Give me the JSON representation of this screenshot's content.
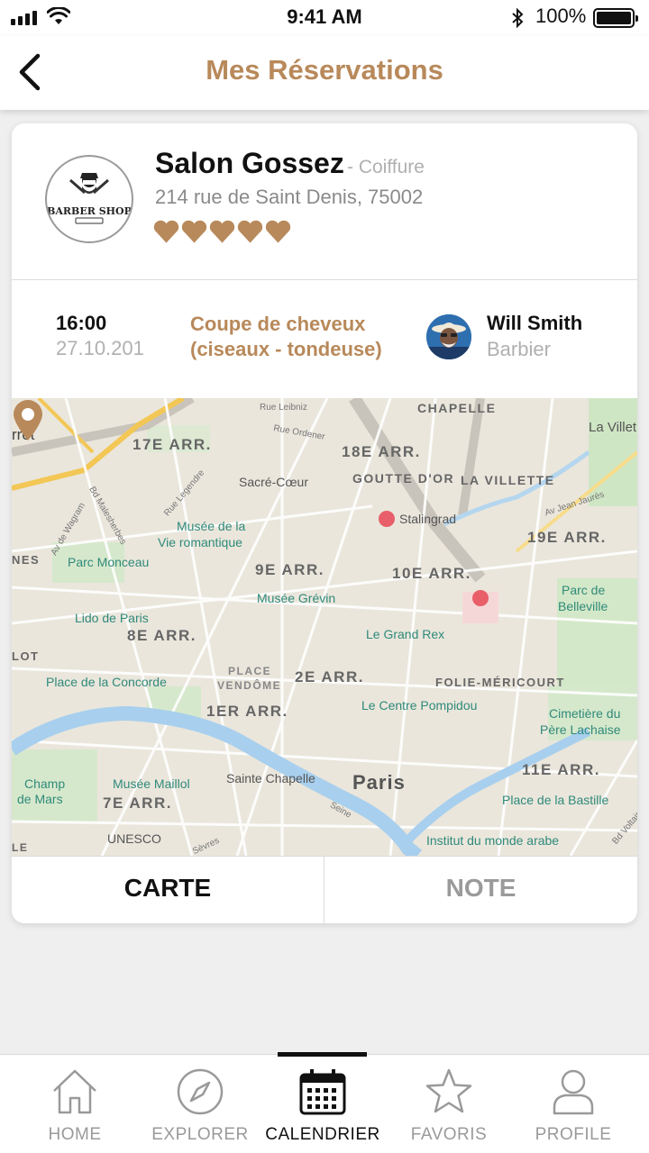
{
  "status": {
    "time": "9:41 AM",
    "battery": "100%"
  },
  "header": {
    "title": "Mes Réservations"
  },
  "salon": {
    "name": "Salon Gossez",
    "category": "- Coiffure",
    "address": "214 rue de Saint Denis, 75002",
    "logo_text": "BARBER SHOP",
    "rating": 5,
    "accent_color": "#b8895a"
  },
  "booking": {
    "time": "16:00",
    "date": "27.10.201",
    "service_line1": "Coupe de cheveux",
    "service_line2": "(ciseaux - tondeuse)",
    "barber_name": "Will Smith",
    "barber_role": "Barbier"
  },
  "map": {
    "labels": {
      "arr17": "17E ARR.",
      "arr18": "18E ARR.",
      "arr19": "19E ARR.",
      "arr9": "9E ARR.",
      "arr10": "10E ARR.",
      "arr8": "8E ARR.",
      "arr2": "2E ARR.",
      "arr1": "1ER ARR.",
      "arr11": "11E ARR.",
      "arr7": "7E ARR.",
      "chapelle": "CHAPELLE",
      "goutte": "GOUTTE D'OR",
      "villette": "LA VILLETTE",
      "villette2": "La Villet",
      "rret": "rret",
      "nes": "NES",
      "lot": "LOT",
      "folie": "FOLIE-MÉRICOURT",
      "placeVendome1": "PLACE",
      "placeVendome2": "VENDÔME",
      "sacre": "Sacré-Cœur",
      "stalingrad": "Stalingrad",
      "museeVie1": "Musée de la",
      "museeVie2": "Vie romantique",
      "parcMonceau": "Parc Monceau",
      "museeGrevin": "Musée Grévin",
      "parcBelleville1": "Parc de",
      "parcBelleville2": "Belleville",
      "lido": "Lido de Paris",
      "grandRex": "Le Grand Rex",
      "concorde": "Place de la Concorde",
      "pompidou": "Le Centre Pompidou",
      "pereLachaise1": "Cimetière du",
      "pereLachaise2": "Père Lachaise",
      "champ1": "Champ",
      "champ2": "de Mars",
      "maillol": "Musée Maillol",
      "chapelle2": "Sainte Chapelle",
      "paris": "Paris",
      "bastille": "Place de la Bastille",
      "unesco": "UNESCO",
      "institut": "Institut du monde arabe",
      "seine": "Seine",
      "le": "LE",
      "rueLeibniz": "Rue Leibniz",
      "rueOrdener": "Rue Ordener",
      "avJaures": "Av Jean Jaurès",
      "bdMalesherbes": "Bd Malesherbes",
      "avWagram": "Av de Wagram",
      "rueLegendre": "Rue Legendre",
      "bdVoltaire": "Bd Voltaire",
      "sevres": "Sèvres"
    }
  },
  "tabs": {
    "carte": "CARTE",
    "note": "NOTE"
  },
  "nav": {
    "home": "HOME",
    "explorer": "EXPLORER",
    "calendrier": "CALENDRIER",
    "favoris": "FAVORIS",
    "profile": "PROFILE",
    "active": "calendrier"
  }
}
